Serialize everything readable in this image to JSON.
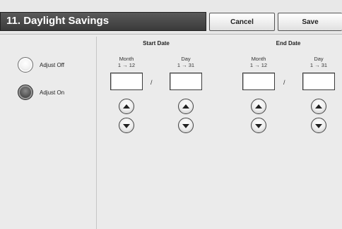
{
  "header": {
    "title": "11. Daylight Savings",
    "cancel_label": "Cancel",
    "save_label": "Save"
  },
  "adjust": {
    "off_label": "Adjust Off",
    "on_label": "Adjust On",
    "selected": "Adjust On"
  },
  "start_date": {
    "title": "Start Date",
    "month_label": "Month",
    "month_range": "1 → 12",
    "month_value": "",
    "separator": "/",
    "day_label": "Day",
    "day_range": "1 → 31",
    "day_value": ""
  },
  "end_date": {
    "title": "End Date",
    "month_label": "Month",
    "month_range": "1 → 12",
    "month_value": "",
    "separator": "/",
    "day_label": "Day",
    "day_range": "1 → 31",
    "day_value": ""
  },
  "icons": {
    "up": "chevron-up-icon",
    "down": "chevron-down-icon"
  }
}
